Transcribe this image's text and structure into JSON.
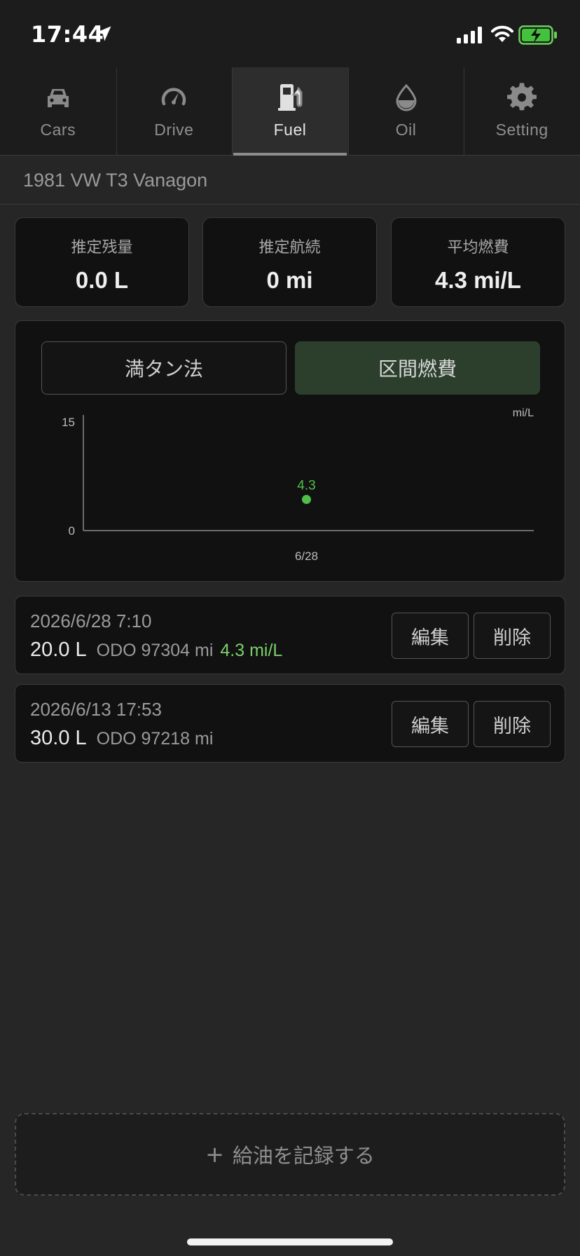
{
  "status_bar": {
    "time": "17:44"
  },
  "tabs": [
    {
      "label": "Cars",
      "icon": "car-icon",
      "active": false
    },
    {
      "label": "Drive",
      "icon": "speedometer-icon",
      "active": false
    },
    {
      "label": "Fuel",
      "icon": "fuel-pump-icon",
      "active": true
    },
    {
      "label": "Oil",
      "icon": "oil-drop-icon",
      "active": false
    },
    {
      "label": "Setting",
      "icon": "gear-icon",
      "active": false
    }
  ],
  "vehicle": {
    "name": "1981 VW T3 Vanagon"
  },
  "stats": [
    {
      "label": "推定残量",
      "value": "0.0 L"
    },
    {
      "label": "推定航続",
      "value": "0 mi"
    },
    {
      "label": "平均燃費",
      "value": "4.3 mi/L"
    }
  ],
  "modes": {
    "full_tank": "満タン法",
    "interval": "区間燃費",
    "selected": "interval"
  },
  "chart_data": {
    "type": "scatter",
    "x": [
      "6/28"
    ],
    "series": [
      {
        "values": [
          4.3
        ]
      }
    ],
    "data_labels": [
      "4.3"
    ],
    "ylim": [
      0,
      15
    ],
    "y_ticks": [
      "0",
      "15"
    ],
    "unit_label": "mi/L",
    "point_color": "#4fbf4a"
  },
  "records": [
    {
      "date": "2026/6/28 7:10",
      "volume": "20.0 L",
      "odo": "ODO 97304 mi",
      "efficiency": "4.3 mi/L",
      "edit_label": "編集",
      "delete_label": "削除"
    },
    {
      "date": "2026/6/13 17:53",
      "volume": "30.0 L",
      "odo": "ODO 97218 mi",
      "efficiency": "",
      "edit_label": "編集",
      "delete_label": "削除"
    }
  ],
  "add_button": {
    "plus": "+",
    "label": "給油を記録する"
  },
  "colors": {
    "accent_green": "#7bcf6a",
    "active_mode_bg": "#2c3f2d",
    "background": "#262626"
  }
}
